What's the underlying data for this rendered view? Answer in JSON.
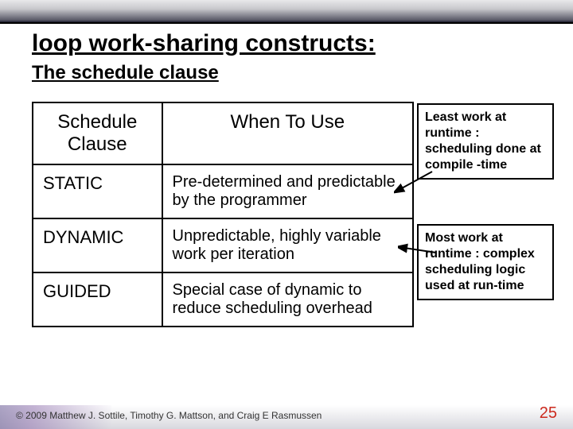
{
  "title": "loop work-sharing constructs:",
  "subtitle": "The schedule clause",
  "table": {
    "headers": [
      "Schedule Clause",
      "When To Use"
    ],
    "rows": [
      {
        "clause": "STATIC",
        "use": "Pre-determined and predictable by the programmer"
      },
      {
        "clause": "DYNAMIC",
        "use": "Unpredictable, highly variable work per iteration"
      },
      {
        "clause": "GUIDED",
        "use": "Special case of dynamic to reduce scheduling overhead"
      }
    ]
  },
  "callouts": [
    "Least work at runtime : scheduling done at compile -time",
    "Most work at runtime : complex scheduling logic used at run-time"
  ],
  "footer": "© 2009 Matthew J. Sottile, Timothy G. Mattson, and Craig E Rasmussen",
  "pagenum": "25"
}
